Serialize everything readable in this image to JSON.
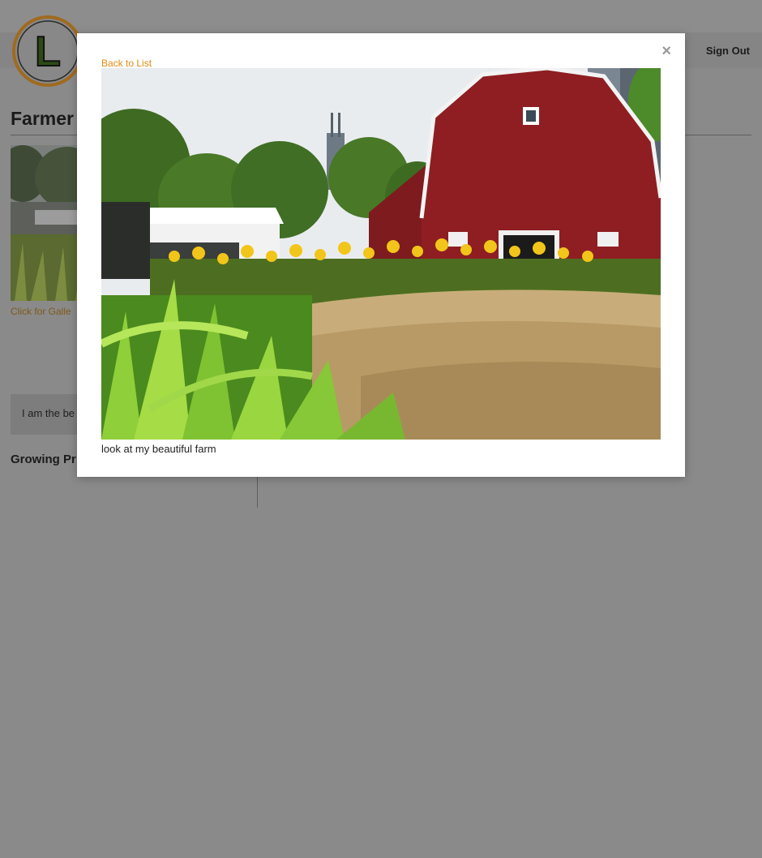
{
  "header": {
    "logo_letter": "L",
    "sign_out_label": "Sign Out"
  },
  "profile": {
    "title": "Farmer",
    "gallery_link": "Click for Galle",
    "bio": "I am the be",
    "growing_heading": "Growing Pr"
  },
  "modal": {
    "back_label": "Back to List",
    "close_label": "×",
    "caption": "look at my beautiful farm"
  },
  "colors": {
    "link_orange": "#e08a12",
    "overlay_gray": "#8a8a8a",
    "logo_ring": "#a06a1e",
    "barn_red": "#8e1e22"
  }
}
